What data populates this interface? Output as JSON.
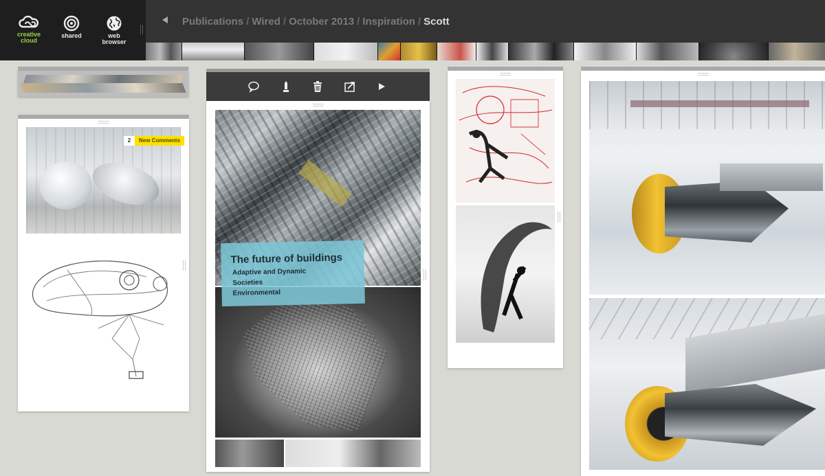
{
  "sidebar": {
    "items": [
      {
        "label_line1": "creative",
        "label_line2": "cloud",
        "icon": "creative-cloud-icon"
      },
      {
        "label_line1": "shared",
        "label_line2": "",
        "icon": "target-icon"
      },
      {
        "label_line1": "web",
        "label_line2": "browser",
        "icon": "globe-icon"
      }
    ]
  },
  "breadcrumb": {
    "back_icon": "triangle-left-icon",
    "items": [
      "Publications",
      "Wired",
      "October 2013",
      "Inspiration"
    ],
    "separator": "/",
    "current": "Scott"
  },
  "toolbar": {
    "icons": [
      "comment-icon",
      "pen-icon",
      "trash-icon",
      "share-icon",
      "play-icon"
    ]
  },
  "comments": {
    "count": "2",
    "label": "New Comments"
  },
  "article": {
    "title": "The future of buildings",
    "tags": [
      "Adaptive and Dynamic",
      "Societies",
      "Environmental"
    ]
  },
  "colors": {
    "sidebar_bg": "#1e1e1e",
    "topbar_bg": "#333333",
    "canvas_bg": "#d9d9d4",
    "breadcrumb_current": "#d7dde2",
    "badge_yellow": "#ffe000",
    "cc_green": "#9fcf4a",
    "overlay_cyan": "#7cc5d6"
  }
}
